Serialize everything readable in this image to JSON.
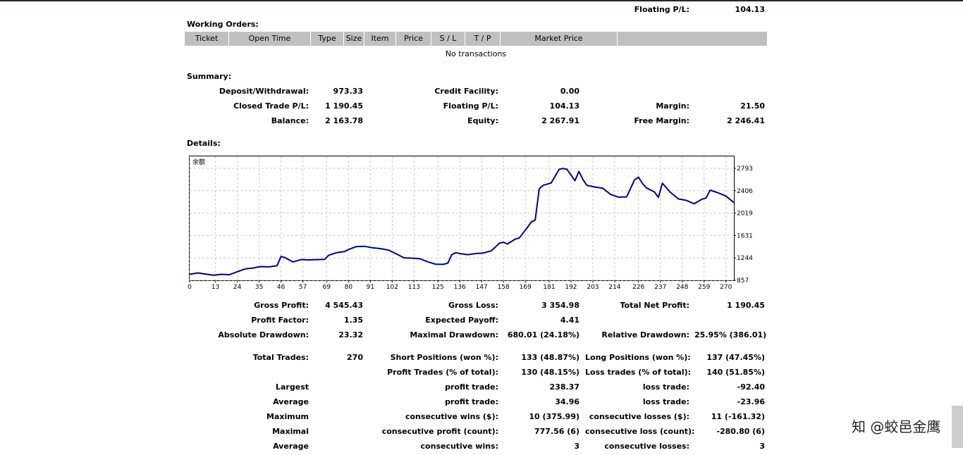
{
  "top_floating": {
    "label": "Floating P/L:",
    "value": "104.13"
  },
  "working_orders": {
    "title": "Working Orders:",
    "columns": [
      "Ticket",
      "Open Time",
      "Type",
      "Size",
      "Item",
      "Price",
      "S / L",
      "T / P",
      "Market Price",
      ""
    ],
    "empty_text": "No transactions"
  },
  "summary": {
    "title": "Summary:",
    "rows": [
      [
        {
          "l": "Deposit/Withdrawal:",
          "v": "973.33"
        },
        {
          "l": "Credit Facility:",
          "v": "0.00"
        },
        {
          "l": "",
          "v": ""
        }
      ],
      [
        {
          "l": "Closed Trade P/L:",
          "v": "1 190.45"
        },
        {
          "l": "Floating P/L:",
          "v": "104.13"
        },
        {
          "l": "Margin:",
          "v": "21.50"
        }
      ],
      [
        {
          "l": "Balance:",
          "v": "2 163.78"
        },
        {
          "l": "Equity:",
          "v": "2 267.91"
        },
        {
          "l": "Free Margin:",
          "v": "2 246.41"
        }
      ]
    ]
  },
  "details": {
    "title": "Details:"
  },
  "chart_data": {
    "type": "line",
    "title": "余额",
    "xlabel": "",
    "ylabel": "",
    "xlim": [
      0,
      274
    ],
    "ylim": [
      857,
      3000
    ],
    "x_ticks": [
      0,
      13,
      24,
      35,
      46,
      57,
      69,
      80,
      91,
      102,
      113,
      125,
      136,
      147,
      158,
      169,
      181,
      192,
      203,
      214,
      226,
      237,
      248,
      259,
      270
    ],
    "y_ticks": [
      857,
      1244,
      1631,
      2019,
      2406,
      2793
    ],
    "grid": true,
    "series": [
      {
        "color": "#00008b",
        "x": [
          0,
          4,
          8,
          12,
          16,
          20,
          24,
          28,
          32,
          34,
          36,
          40,
          44,
          46,
          48,
          52,
          56,
          60,
          64,
          68,
          70,
          74,
          78,
          80,
          84,
          88,
          92,
          96,
          100,
          104,
          108,
          112,
          116,
          120,
          124,
          128,
          130,
          132,
          134,
          136,
          140,
          144,
          148,
          152,
          156,
          158,
          160,
          164,
          166,
          170,
          172,
          174,
          176,
          178,
          182,
          186,
          188,
          190,
          194,
          196,
          198,
          200,
          204,
          208,
          212,
          216,
          220,
          224,
          226,
          228,
          230,
          234,
          236,
          238,
          242,
          246,
          250,
          254,
          258,
          260,
          262,
          266,
          270,
          274
        ],
        "y": [
          960,
          985,
          965,
          945,
          960,
          955,
          1005,
          1055,
          1070,
          1085,
          1095,
          1090,
          1110,
          1270,
          1250,
          1175,
          1215,
          1210,
          1215,
          1220,
          1290,
          1335,
          1355,
          1390,
          1440,
          1445,
          1420,
          1405,
          1380,
          1315,
          1245,
          1240,
          1230,
          1175,
          1135,
          1135,
          1155,
          1300,
          1335,
          1320,
          1300,
          1320,
          1330,
          1370,
          1500,
          1515,
          1485,
          1570,
          1590,
          1770,
          1865,
          1900,
          2440,
          2500,
          2540,
          2775,
          2790,
          2775,
          2580,
          2740,
          2600,
          2500,
          2470,
          2450,
          2340,
          2295,
          2300,
          2595,
          2640,
          2530,
          2455,
          2385,
          2290,
          2535,
          2380,
          2265,
          2240,
          2180,
          2260,
          2280,
          2415,
          2370,
          2315,
          2200
        ]
      }
    ]
  },
  "stats": {
    "rows": [
      {
        "top": 433,
        "c": [
          {
            "l": "Gross Profit:",
            "v": "4 545.43"
          },
          {
            "l": "Gross Loss:",
            "v": "3 354.98"
          },
          {
            "l": "Total Net Profit:",
            "v": "1 190.45"
          }
        ]
      },
      {
        "top": 454,
        "c": [
          {
            "l": "Profit Factor:",
            "v": "1.35"
          },
          {
            "l": "Expected Payoff:",
            "v": "4.41"
          },
          {
            "l": "",
            "v": ""
          }
        ]
      },
      {
        "top": 475,
        "c": [
          {
            "l": "Absolute Drawdown:",
            "v": "23.32"
          },
          {
            "l": "Maximal Drawdown:",
            "v": "680.01 (24.18%)"
          },
          {
            "l": "Relative Drawdown:",
            "v": "25.95% (386.01)"
          }
        ]
      },
      {
        "top": 507,
        "c": [
          {
            "l": "Total Trades:",
            "v": "270"
          },
          {
            "l": "Short Positions (won %):",
            "v": "133 (48.87%)"
          },
          {
            "l": "Long Positions (won %):",
            "v": "137 (47.45%)"
          }
        ]
      },
      {
        "top": 528,
        "c": [
          {
            "l": "",
            "v": ""
          },
          {
            "l": "Profit Trades (% of total):",
            "v": "130 (48.15%)"
          },
          {
            "l": "Loss trades (% of total):",
            "v": "140 (51.85%)"
          }
        ]
      },
      {
        "top": 549,
        "c": [
          {
            "l": "Largest",
            "v": ""
          },
          {
            "l": "profit trade:",
            "v": "238.37"
          },
          {
            "l": "loss trade:",
            "v": "-92.40"
          }
        ]
      },
      {
        "top": 570,
        "c": [
          {
            "l": "Average",
            "v": ""
          },
          {
            "l": "profit trade:",
            "v": "34.96"
          },
          {
            "l": "loss trade:",
            "v": "-23.96"
          }
        ]
      },
      {
        "top": 591,
        "c": [
          {
            "l": "Maximum",
            "v": ""
          },
          {
            "l": "consecutive wins ($):",
            "v": "10 (375.99)"
          },
          {
            "l": "consecutive losses ($):",
            "v": "11 (-161.32)"
          }
        ]
      },
      {
        "top": 612,
        "c": [
          {
            "l": "Maximal",
            "v": ""
          },
          {
            "l": "consecutive profit (count):",
            "v": "777.56 (6)"
          },
          {
            "l": "consecutive loss (count):",
            "v": "-280.80 (6)"
          }
        ]
      },
      {
        "top": 633,
        "c": [
          {
            "l": "Average",
            "v": ""
          },
          {
            "l": "consecutive wins:",
            "v": "3"
          },
          {
            "l": "consecutive losses:",
            "v": "3"
          }
        ]
      }
    ]
  },
  "watermark": "知 @蛟邑金鹰"
}
